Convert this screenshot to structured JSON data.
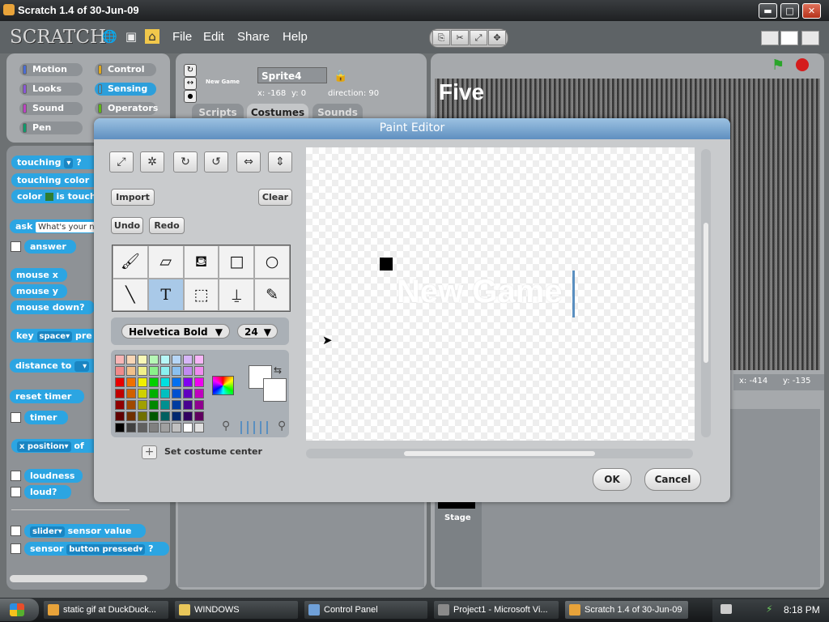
{
  "window": {
    "title": "Scratch 1.4 of 30-Jun-09",
    "btn_min": "▬",
    "btn_max": "□",
    "btn_close": "✕"
  },
  "menu": {
    "logo": "SCRATCH",
    "file": "File",
    "edit": "Edit",
    "share": "Share",
    "help": "Help"
  },
  "categories": [
    "Motion",
    "Control",
    "Looks",
    "Sensing",
    "Sound",
    "Operators",
    "Pen"
  ],
  "category_colors": [
    "#4a6cd4",
    "#e1a91a",
    "#8a55d7",
    "#2ca5e2",
    "#bb42c3",
    "#5cb712",
    "#0e9a6c"
  ],
  "blocks": {
    "touching": "touching",
    "touching_q": "?",
    "touching_color": "touching color",
    "color_is_touching": "color",
    "color_is_touching2": "is touch",
    "ask": "ask",
    "ask_default": "What's your n",
    "answer": "answer",
    "mouse_x": "mouse x",
    "mouse_y": "mouse y",
    "mouse_down": "mouse down?",
    "key": "key",
    "key_default": "space",
    "key_pressed": "pre",
    "distance_to": "distance to",
    "reset_timer": "reset timer",
    "timer": "timer",
    "x_position": "x position",
    "of": "of",
    "loudness": "loudness",
    "loud": "loud?",
    "slider": "slider",
    "sensor_value": "sensor value",
    "sensor": "sensor",
    "button_pressed": "button pressed",
    "sensor_q": "?"
  },
  "sprite": {
    "name": "Sprite4",
    "thumb_text": "New Game",
    "x_label": "x:",
    "x": "-168",
    "y_label": "y:",
    "y": "0",
    "direction_label": "direction:",
    "direction": "90"
  },
  "tabs": [
    "Scripts",
    "Costumes",
    "Sounds"
  ],
  "stage": {
    "text": "Five",
    "mouse_x_label": "x:",
    "mouse_x": "-414",
    "mouse_y_label": "y:",
    "mouse_y": "-135",
    "thumb_label": "Stage"
  },
  "paint_editor": {
    "title": "Paint Editor",
    "import": "Import",
    "clear": "Clear",
    "undo": "Undo",
    "redo": "Redo",
    "font": "Helvetica Bold",
    "font_size": "24",
    "set_center": "Set costume center",
    "canvas_text": "New Game",
    "ok": "OK",
    "cancel": "Cancel",
    "palette": [
      "#f7b6b6",
      "#f7d6b6",
      "#f7f7b6",
      "#b6f7b6",
      "#b6f7f7",
      "#b6d6f7",
      "#d6b6f7",
      "#f7b6f7",
      "#f08a8a",
      "#f0c08a",
      "#f0f08a",
      "#8af08a",
      "#8af0f0",
      "#8ac0f0",
      "#c08af0",
      "#f08af0",
      "#e80000",
      "#f07000",
      "#f0f000",
      "#00d000",
      "#00e0e0",
      "#0070f0",
      "#8000f0",
      "#f000f0",
      "#c00000",
      "#d06000",
      "#d0d000",
      "#00b000",
      "#00c0c0",
      "#0050d0",
      "#6000c0",
      "#c000c0",
      "#900000",
      "#a04800",
      "#a0a000",
      "#008800",
      "#009090",
      "#003ca0",
      "#480090",
      "#900090",
      "#600000",
      "#703000",
      "#707000",
      "#005800",
      "#006060",
      "#002870",
      "#300060",
      "#600060",
      "#000000",
      "#404040",
      "#606060",
      "#808080",
      "#a0a0a0",
      "#c0c0c0",
      "#ffffff",
      "#e0e0e0"
    ]
  },
  "taskbar": {
    "start": "",
    "tasks": [
      "static gif at DuckDuck...",
      "WINDOWS",
      "Control Panel",
      "Project1 - Microsoft Vi...",
      "Scratch 1.4 of 30-Jun-09"
    ],
    "time": "8:18 PM"
  }
}
